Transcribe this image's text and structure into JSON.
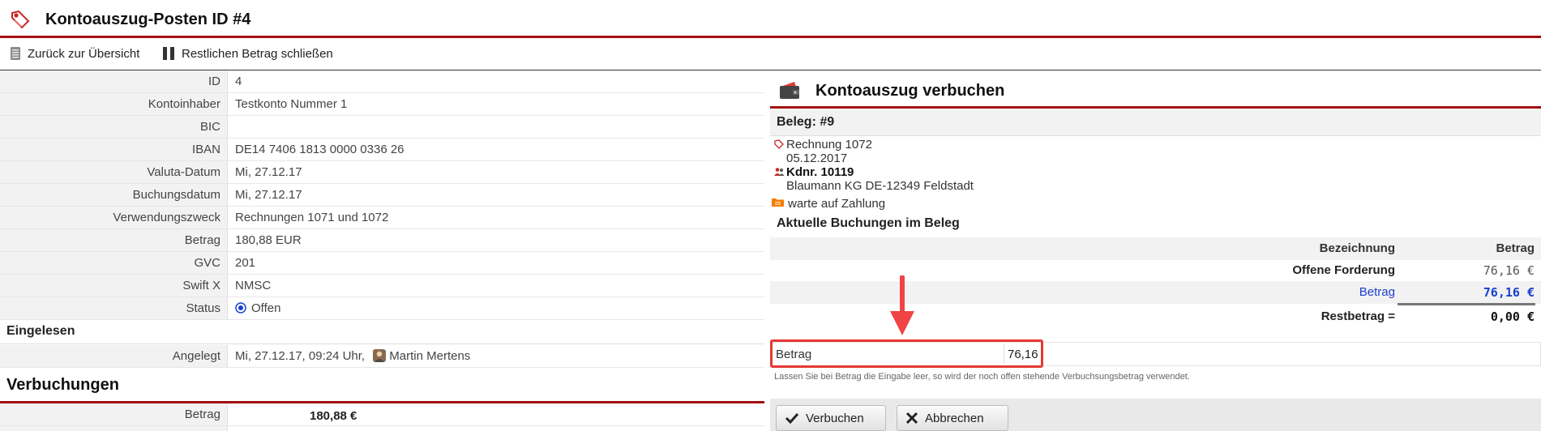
{
  "page": {
    "title": "Kontoauszug-Posten ID #4"
  },
  "toolbar": {
    "back_label": "Zurück zur Übersicht",
    "close_rest_label": "Restlichen Betrag schließen"
  },
  "details": [
    {
      "label": "ID",
      "value": "4"
    },
    {
      "label": "Kontoinhaber",
      "value": "Testkonto Nummer 1"
    },
    {
      "label": "BIC",
      "value": ""
    },
    {
      "label": "IBAN",
      "value": "DE14 7406 1813 0000 0336 26"
    },
    {
      "label": "Valuta-Datum",
      "value": "Mi, 27.12.17"
    },
    {
      "label": "Buchungsdatum",
      "value": "Mi, 27.12.17"
    },
    {
      "label": "Verwendungszweck",
      "value": "Rechnungen 1071 und 1072"
    },
    {
      "label": "Betrag",
      "value": "180,88 EUR"
    },
    {
      "label": "GVC",
      "value": "201"
    },
    {
      "label": "Swift X",
      "value": "NMSC"
    },
    {
      "label": "Status",
      "value": "Offen"
    }
  ],
  "eingelesen": {
    "heading": "Eingelesen",
    "angelegt_label": "Angelegt",
    "angelegt_value": "Mi, 27.12.17, 09:24 Uhr,",
    "angelegt_user": "Martin Mertens"
  },
  "verbuchungen": {
    "heading": "Verbuchungen",
    "betrag_label": "Betrag",
    "betrag_value": "180,88 €"
  },
  "right_panel": {
    "title": "Kontoauszug verbuchen",
    "beleg_label": "Beleg: #9",
    "invoice_name": "Rechnung 1072",
    "invoice_date": "05.12.2017",
    "customer_no": "Kdnr. 10119",
    "customer_address": "Blaumann KG DE-12349 Feldstadt",
    "status": "warte auf Zahlung",
    "aktuelle_heading": "Aktuelle Buchungen im Beleg",
    "table": {
      "header_bezeichnung": "Bezeichnung",
      "header_betrag": "Betrag",
      "rows": [
        {
          "label": "Offene Forderung",
          "value": "76,16 €"
        },
        {
          "label": "Betrag",
          "value": "76,16 €"
        },
        {
          "label": "Restbetrag =",
          "value": "0,00 €"
        }
      ]
    },
    "input": {
      "label": "Betrag",
      "value": "76,16",
      "hint": "Lassen Sie bei Betrag die Eingabe leer, so wird der noch offen stehende Verbuchsungsbetrag verwendet."
    },
    "buttons": {
      "submit": "Verbuchen",
      "cancel": "Abbrechen"
    }
  },
  "colors": {
    "accent_red": "#a30d12",
    "highlight_red": "#e53935",
    "link_blue": "#1a3fd1"
  }
}
